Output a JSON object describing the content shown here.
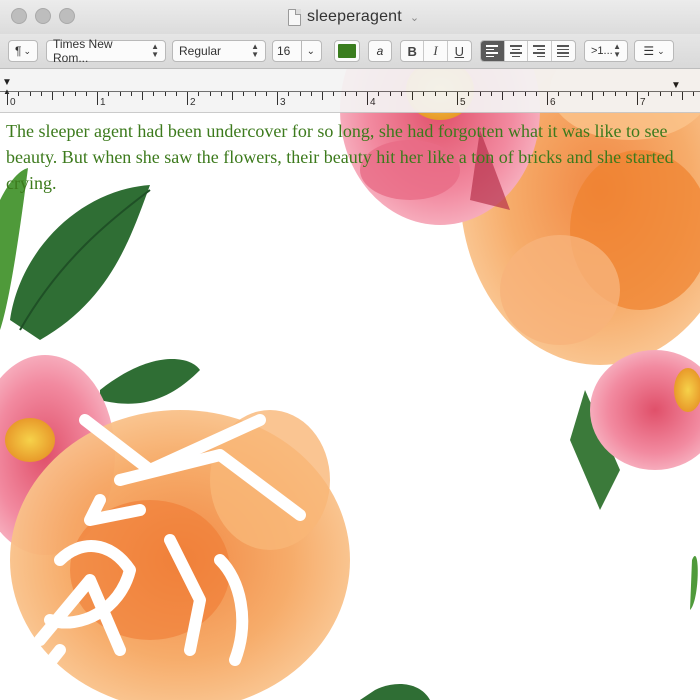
{
  "window": {
    "title": "sleeperagent"
  },
  "toolbar": {
    "paragraph_label": "¶",
    "font_family": "Times New Rom...",
    "font_style": "Regular",
    "font_size": "16",
    "text_color": "#3a7d1e",
    "highlight_label": "a",
    "bold_label": "B",
    "italic_label": "I",
    "underline_label": "U",
    "spacing_label": ">1...",
    "list_label": "☰"
  },
  "ruler": {
    "numbers": [
      "0",
      "1",
      "2",
      "3",
      "4",
      "5",
      "6",
      "7"
    ]
  },
  "document": {
    "text_color": "#3c7a1c",
    "body": "The sleeper agent had been undercover for so long, she had forgotten what it was like to see beauty. But when she saw the flowers, their beauty hit her like a ton of bricks and she started crying."
  },
  "icons": {
    "close": "close-icon",
    "minimize": "minimize-icon",
    "zoom": "zoom-icon",
    "document": "document-icon",
    "title_menu": "chevron-down-icon",
    "left_indent": "left-indent-marker-icon",
    "right_indent": "right-indent-marker-icon"
  }
}
